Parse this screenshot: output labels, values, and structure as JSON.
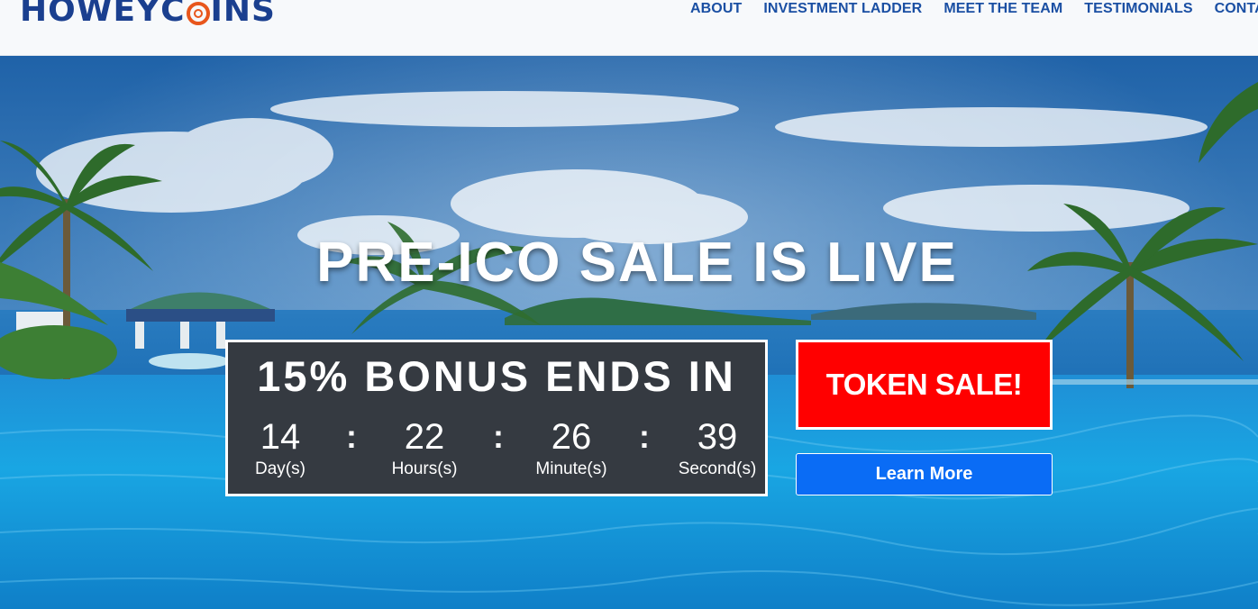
{
  "brand": {
    "logo_before": "HOWEY",
    "logo_after": "COINS"
  },
  "nav": {
    "items": [
      {
        "label": "ABOUT"
      },
      {
        "label": "INVESTMENT LADDER"
      },
      {
        "label": "MEET THE TEAM"
      },
      {
        "label": "TESTIMONIALS"
      },
      {
        "label": "CONTACT"
      }
    ]
  },
  "hero": {
    "headline": "PRE-ICO SALE IS LIVE",
    "countdown": {
      "title": "15% BONUS ENDS IN",
      "separator": ":",
      "units": [
        {
          "value": "14",
          "label": "Day(s)"
        },
        {
          "value": "22",
          "label": "Hours(s)"
        },
        {
          "value": "26",
          "label": "Minute(s)"
        },
        {
          "value": "39",
          "label": "Second(s)"
        }
      ]
    },
    "token_sale_label": "TOKEN SALE!",
    "learn_more_label": "Learn More"
  },
  "colors": {
    "brand_blue": "#1a3f8f",
    "nav_blue": "#1a4fa3",
    "logo_orange": "#e8561c",
    "countdown_bg": "#353a41",
    "token_red": "#ff0000",
    "learn_blue": "#0a6cf5"
  }
}
